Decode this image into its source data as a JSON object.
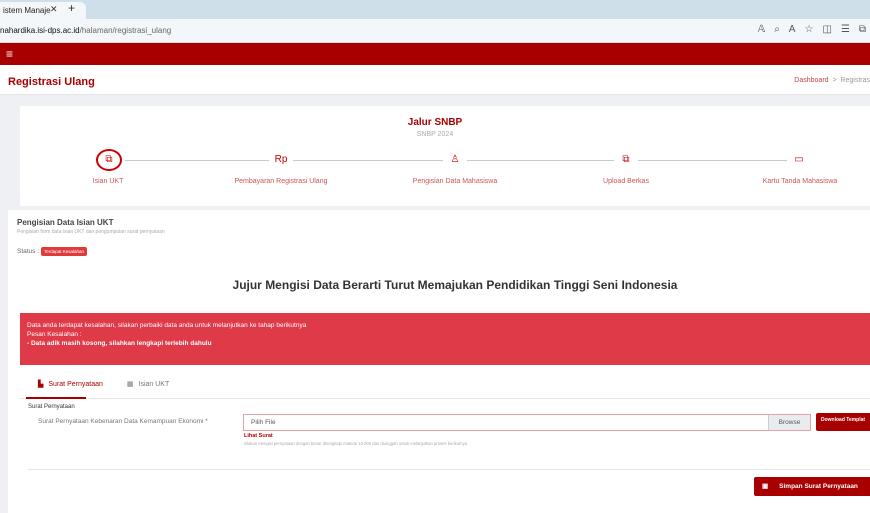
{
  "browser": {
    "tab_title": "istem Manaje",
    "url_domain": "nahardika.isi-dps.ac.id",
    "url_path": "/halaman/registrasi_ulang",
    "icons": [
      "read-aloud-icon",
      "zoom-icon",
      "text-size-icon",
      "favorite-icon",
      "split-screen-icon",
      "favorites-bar-icon",
      "collections-icon"
    ]
  },
  "header": {
    "page_title": "Registrasi Ulang",
    "breadcrumb_home": "Dashboard",
    "breadcrumb_sep": ">",
    "breadcrumb_current": "Registras"
  },
  "stepper": {
    "title": "Jalur SNBP",
    "subtitle": "SNBP 2024",
    "steps": [
      {
        "label": "Isian UKT",
        "icon": "document-icon",
        "glyph": "⧉"
      },
      {
        "label": "Pembayaran Registrasi Ulang",
        "icon": "rupiah-icon",
        "glyph": "Rp"
      },
      {
        "label": "Pengisian Data Mahasiswa",
        "icon": "user-icon",
        "glyph": "♙"
      },
      {
        "label": "Upload Berkas",
        "icon": "files-icon",
        "glyph": "⧉"
      },
      {
        "label": "Kartu Tanda Mahasiswa",
        "icon": "card-icon",
        "glyph": "▭"
      }
    ]
  },
  "section": {
    "title": "Pengisian Data Isian UKT",
    "subtitle": "Pengisian form data isian UKT dan pengumpulan surat pernyataan",
    "status_label": "Status :",
    "status_value": "Terdapat Kesalahan"
  },
  "headline": "Jujur Mengisi Data Berarti Turut Memajukan Pendidikan Tinggi Seni Indonesia",
  "alert": {
    "line1": "Data anda terdapat kesalahan, silakan perbaiki data anda untuk melanjutkan ke tahap berikutnya",
    "line2": "Pesan Kesalahan :",
    "line3": "- Data adik masih kosong, silahkan lengkapi terlebih dahulu"
  },
  "tabs": [
    {
      "label": "Surat Pernyataan",
      "icon": "file-pdf-icon",
      "active": true
    },
    {
      "label": "Isian UKT",
      "icon": "table-icon",
      "active": false
    }
  ],
  "form": {
    "title": "Surat Pernyataan",
    "field_label": "Surat Pernyataan Kebenaran Data Kemampuan Ekonomi *",
    "file_value": "Pilih File",
    "browse_label": "Browse",
    "download_label": "Download Templat",
    "lihat_label": "Lihat Surat",
    "hint": "silakan mengisi pernyataan dengan benar ditengkapi materai 10.000 dan diunggah untuk melanjutkan proses berikutnya",
    "save_label": "Simpan Surat Pernyataan"
  },
  "colors": {
    "brand": "#a80000",
    "alert": "#df3a48",
    "status_badge": "#e03b3b"
  }
}
